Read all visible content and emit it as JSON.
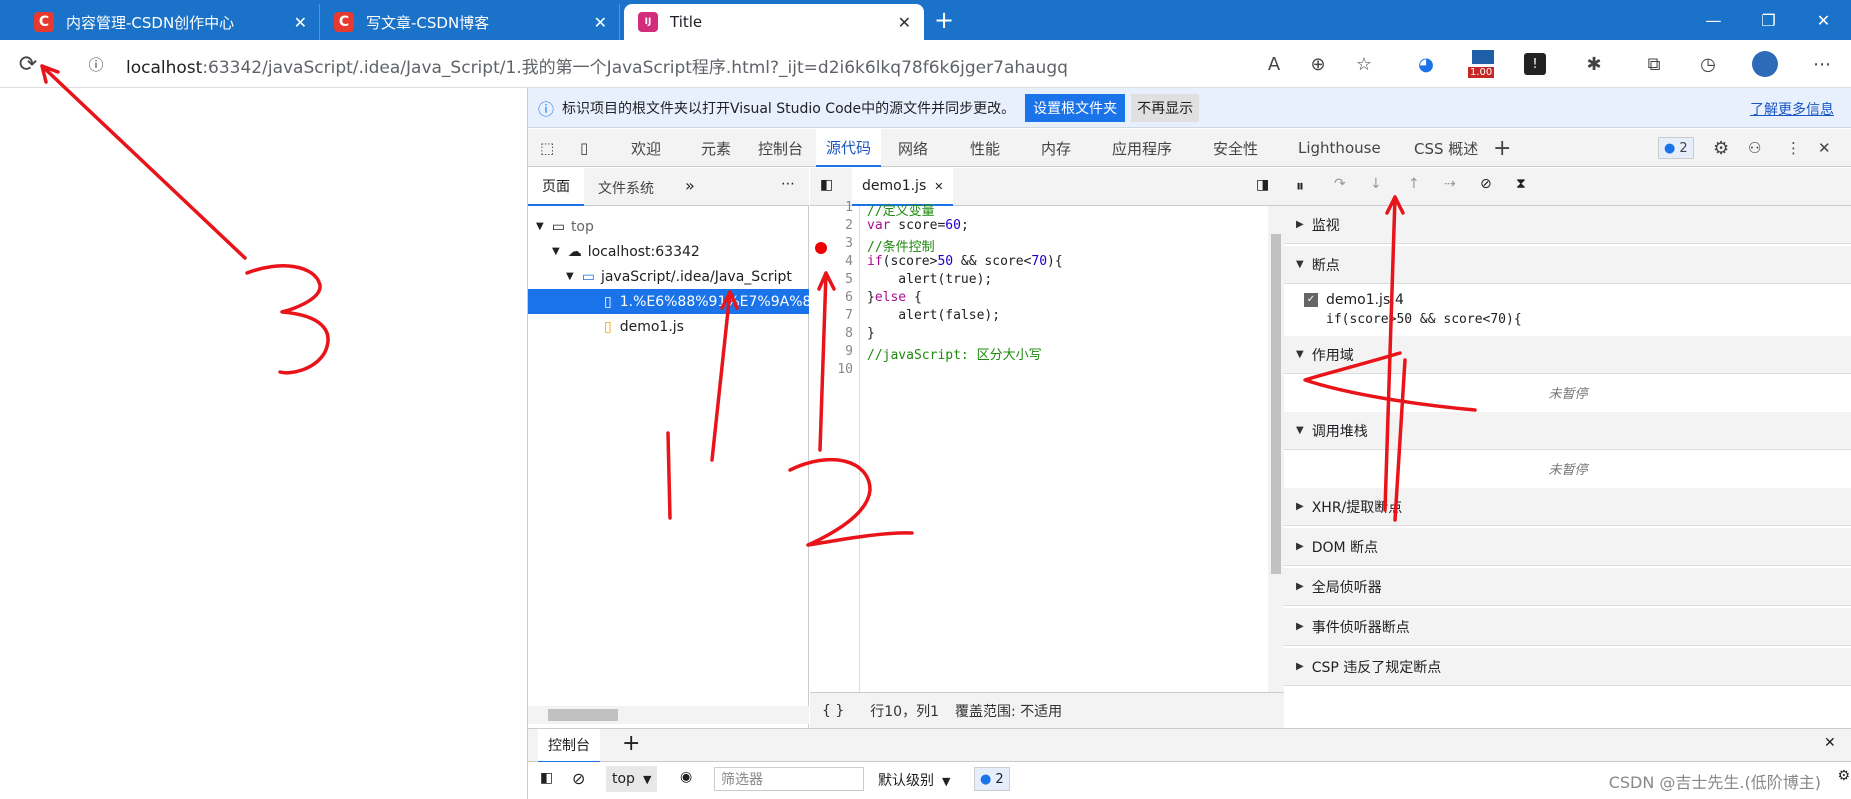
{
  "browser": {
    "tabs": [
      {
        "title": "内容管理-CSDN创作中心",
        "icon": "csdn-logo",
        "icon_letter": "C",
        "icon_color": "#e8392e"
      },
      {
        "title": "写文章-CSDN博客",
        "icon": "csdn-logo",
        "icon_letter": "C",
        "icon_color": "#e8392e"
      },
      {
        "title": "Title",
        "icon": "jetbrains-logo",
        "icon_letter": "IJ",
        "icon_color": "#d22c7c"
      }
    ],
    "new_tab": "+",
    "address": {
      "host": "localhost",
      "path": ":63342/javaScript/.idea/Java_Script/1.我的第一个JavaScript程序.html?_ijt=d2i6k6lkq78f6k6jger7ahaugq"
    },
    "extension_badge": "1.00"
  },
  "devtools": {
    "info": {
      "text": "标识项目的根文件夹以打开Visual Studio Code中的源文件并同步更改。",
      "primary": "设置根文件夹",
      "secondary": "不再显示",
      "link": "了解更多信息"
    },
    "tabs": [
      "欢迎",
      "元素",
      "控制台",
      "源代码",
      "网络",
      "性能",
      "内存",
      "应用程序",
      "安全性",
      "Lighthouse",
      "CSS 概述"
    ],
    "active_tab": "源代码",
    "issues_count": "2",
    "navigator": {
      "tabs": [
        "页面",
        "文件系统"
      ],
      "tree": [
        {
          "label": "top",
          "depth": 0,
          "icon": "frame-icon"
        },
        {
          "label": "localhost:63342",
          "depth": 1,
          "icon": "cloud-icon"
        },
        {
          "label": "javaScript/.idea/Java_Script",
          "depth": 2,
          "icon": "folder-icon"
        },
        {
          "label": "1.%E6%88%91%E7%9A%84",
          "depth": 3,
          "icon": "file-icon",
          "selected": true
        },
        {
          "label": "demo1.js",
          "depth": 3,
          "icon": "file-icon"
        }
      ]
    },
    "editor": {
      "file_tab": "demo1.js",
      "line_numbers": [
        "1",
        "2",
        "3",
        "4",
        "5",
        "6",
        "7",
        "8",
        "9",
        "10"
      ],
      "lines": [
        "//定义变量",
        "var score=60;",
        "//条件控制",
        "if(score>50 && score<70){",
        "    alert(true);",
        "}else {",
        "    alert(false);",
        "}",
        "//javaScript: 区分大小写",
        ""
      ],
      "breakpoint_line": "4",
      "status_position": "行10，列1",
      "status_coverage": "覆盖范围: 不适用",
      "pretty_print": "{ }"
    },
    "debugger": {
      "sections": [
        "监视",
        "断点",
        "作用域",
        "调用堆栈",
        "XHR/提取断点",
        "DOM 断点",
        "全局侦听器",
        "事件侦听器断点",
        "CSP 违反了规定断点"
      ],
      "breakpoint_file": "demo1.js:4",
      "breakpoint_code": "if(score>50 && score<70){",
      "not_paused": "未暂停"
    },
    "drawer": {
      "tab": "控制台",
      "context": "top",
      "filter_placeholder": "筛选器",
      "level": "默认级别",
      "issues": "2"
    }
  },
  "annotations": {
    "numbers": [
      "1",
      "2",
      "3",
      "4"
    ],
    "color": "#e8141a"
  },
  "watermark": "CSDN @吉士先生.(低阶博主)"
}
